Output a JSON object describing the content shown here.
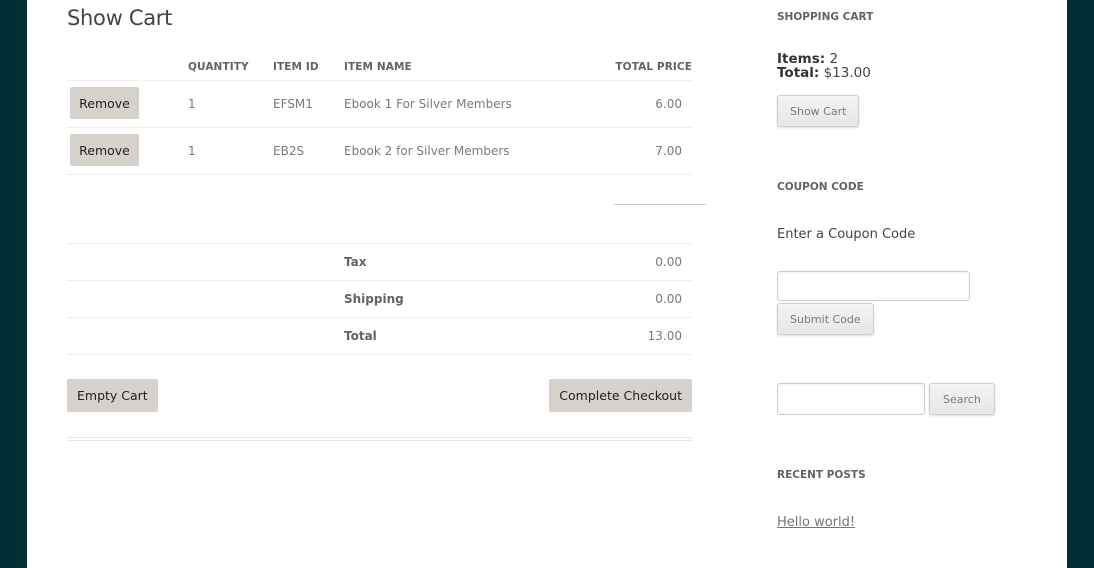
{
  "main": {
    "title": "Show Cart",
    "table": {
      "headers": [
        "",
        "QUANTITY",
        "ITEM ID",
        "ITEM NAME",
        "TOTAL PRICE"
      ],
      "rows": [
        {
          "action": "Remove",
          "quantity": "1",
          "item_id": "EFSM1",
          "item_name": "Ebook 1 For Silver Members",
          "total_price": "6.00"
        },
        {
          "action": "Remove",
          "quantity": "1",
          "item_id": "EB2S",
          "item_name": "Ebook 2 for Silver Members",
          "total_price": "7.00"
        }
      ]
    },
    "summary": {
      "tax_label": "Tax",
      "tax_value": "0.00",
      "shipping_label": "Shipping",
      "shipping_value": "0.00",
      "total_label": "Total",
      "total_value": "13.00"
    },
    "buttons": {
      "empty_cart": "Empty Cart",
      "complete_checkout": "Complete Checkout"
    }
  },
  "sidebar": {
    "shopping_cart": {
      "title": "SHOPPING CART",
      "items_label": "Items:",
      "items_value": "2",
      "total_label": "Total:",
      "total_value": "$13.00",
      "show_cart_button": "Show Cart"
    },
    "coupon": {
      "title": "COUPON CODE",
      "prompt": "Enter a Coupon Code",
      "input_value": "",
      "submit_button": "Submit Code"
    },
    "search": {
      "input_value": "",
      "button": "Search"
    },
    "recent_posts": {
      "title": "RECENT POSTS",
      "posts": [
        "Hello world!"
      ]
    }
  },
  "colors": {
    "frame": "#022e37",
    "button_bg": "#d6d2cb"
  }
}
